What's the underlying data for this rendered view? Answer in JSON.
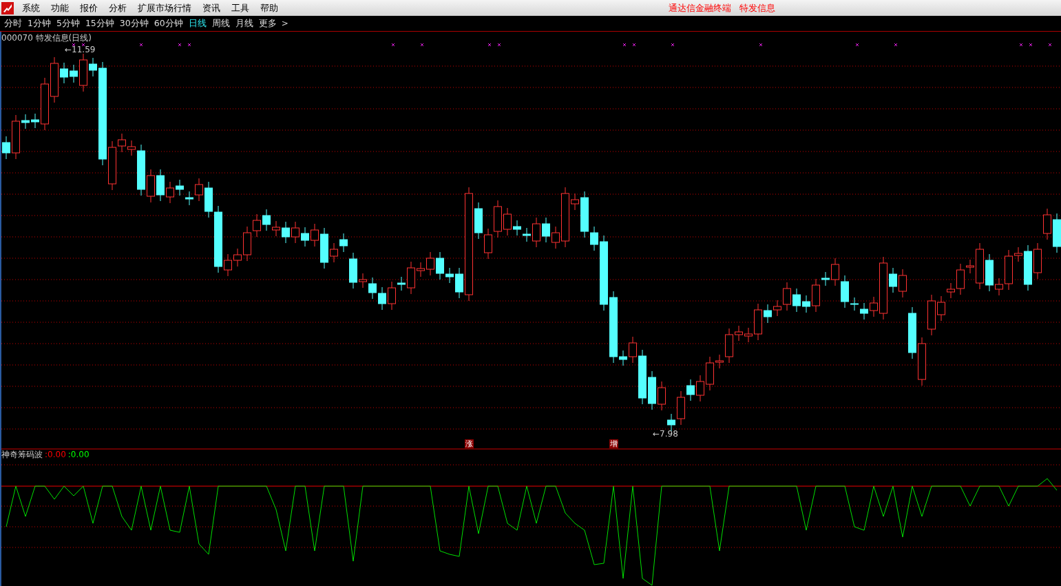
{
  "menu_bar": {
    "items": [
      "系统",
      "功能",
      "报价",
      "分析",
      "扩展市场行情",
      "资讯",
      "工具",
      "帮助"
    ],
    "title_right": [
      "通达信金融终端",
      "特发信息"
    ]
  },
  "period_tabs": [
    {
      "label": "分时",
      "selected": false
    },
    {
      "label": "1分钟",
      "selected": false
    },
    {
      "label": "5分钟",
      "selected": false
    },
    {
      "label": "15分钟",
      "selected": false
    },
    {
      "label": "30分钟",
      "selected": false
    },
    {
      "label": "60分钟",
      "selected": false
    },
    {
      "label": "日线",
      "selected": true
    },
    {
      "label": "周线",
      "selected": false
    },
    {
      "label": "月线",
      "selected": false
    },
    {
      "label": "更多",
      "selected": false
    }
  ],
  "more_arrow": ">",
  "chart": {
    "title": "000070 特发信息(日线)",
    "high_label": "←11.59",
    "low_label": "←7.98",
    "signals": [
      "涨",
      "增"
    ]
  },
  "indicator": {
    "name": "神奇筹码波",
    "values": [
      {
        "text": ":0.00",
        "color": "#ff0000"
      },
      {
        "text": ":0.00",
        "color": "#00ff00"
      }
    ]
  }
}
